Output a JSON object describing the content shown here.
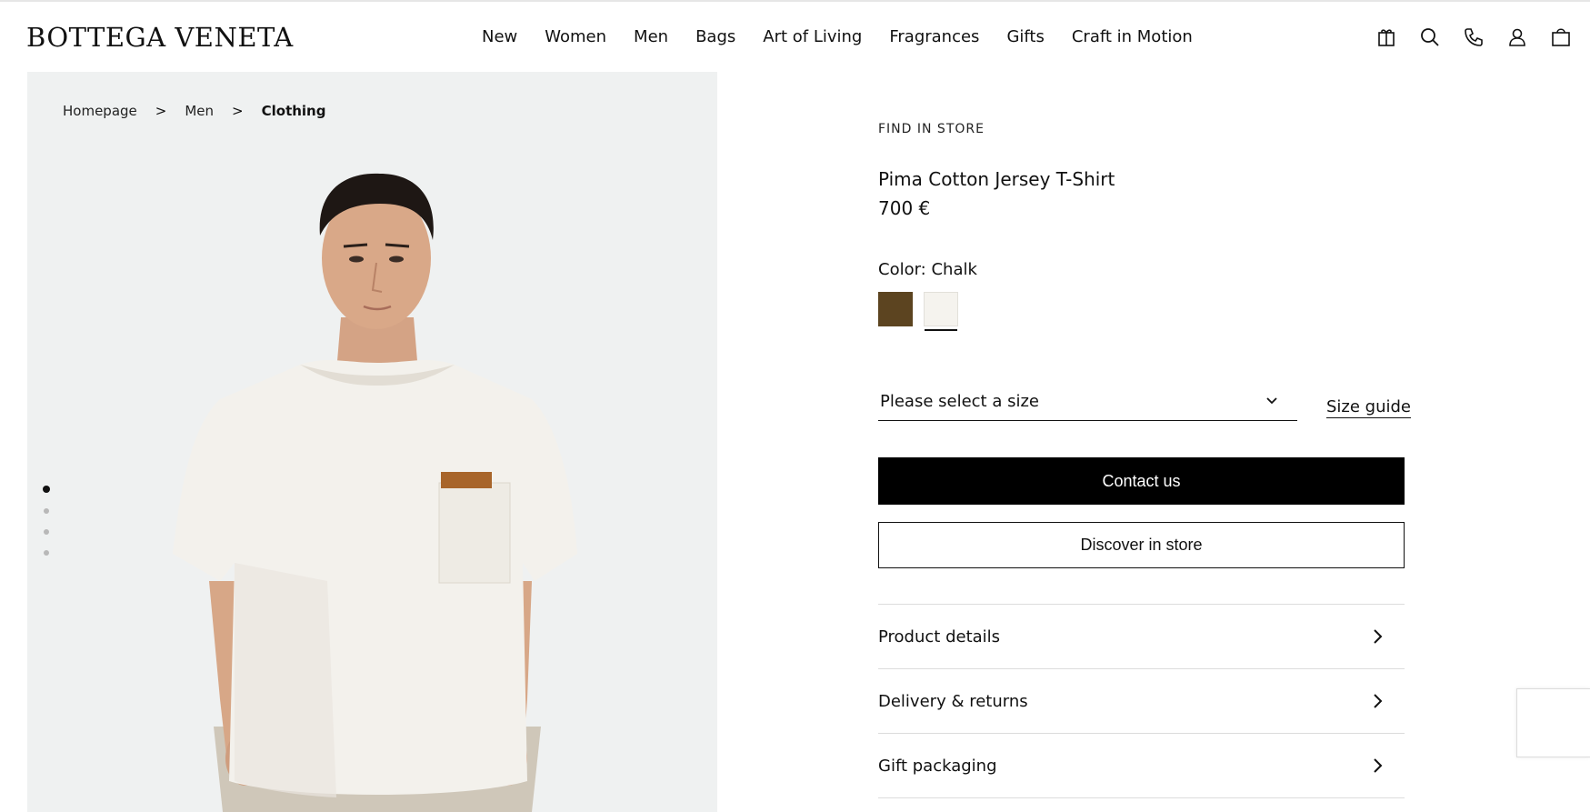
{
  "header": {
    "logo": "BOTTEGA VENETA",
    "nav": [
      {
        "label": "New"
      },
      {
        "label": "Women"
      },
      {
        "label": "Men"
      },
      {
        "label": "Bags"
      },
      {
        "label": "Art of Living"
      },
      {
        "label": "Fragrances"
      },
      {
        "label": "Gifts"
      },
      {
        "label": "Craft in Motion"
      }
    ],
    "icons": [
      "gift-icon",
      "search-icon",
      "phone-icon",
      "account-icon",
      "bag-icon"
    ]
  },
  "breadcrumb": {
    "items": [
      "Homepage",
      "Men",
      "Clothing"
    ],
    "separator": ">"
  },
  "gallery": {
    "dot_count": 4,
    "active_index": 0
  },
  "product": {
    "find_in_store": "FIND IN STORE",
    "name": "Pima Cotton Jersey T-Shirt",
    "price": "700 €",
    "color_label": "Color: Chalk",
    "swatches": [
      {
        "name": "brown",
        "color": "#5c4420"
      },
      {
        "name": "chalk",
        "color": "#f5f3ee",
        "selected": true
      }
    ],
    "size_placeholder": "Please select a size",
    "size_guide": "Size guide",
    "contact_button": "Contact us",
    "store_button": "Discover in store",
    "accordion": [
      {
        "label": "Product details"
      },
      {
        "label": "Delivery & returns"
      },
      {
        "label": "Gift packaging"
      }
    ]
  },
  "colors": {
    "primary": "#000000",
    "background": "#ffffff",
    "image_bg": "#eff1f1"
  }
}
